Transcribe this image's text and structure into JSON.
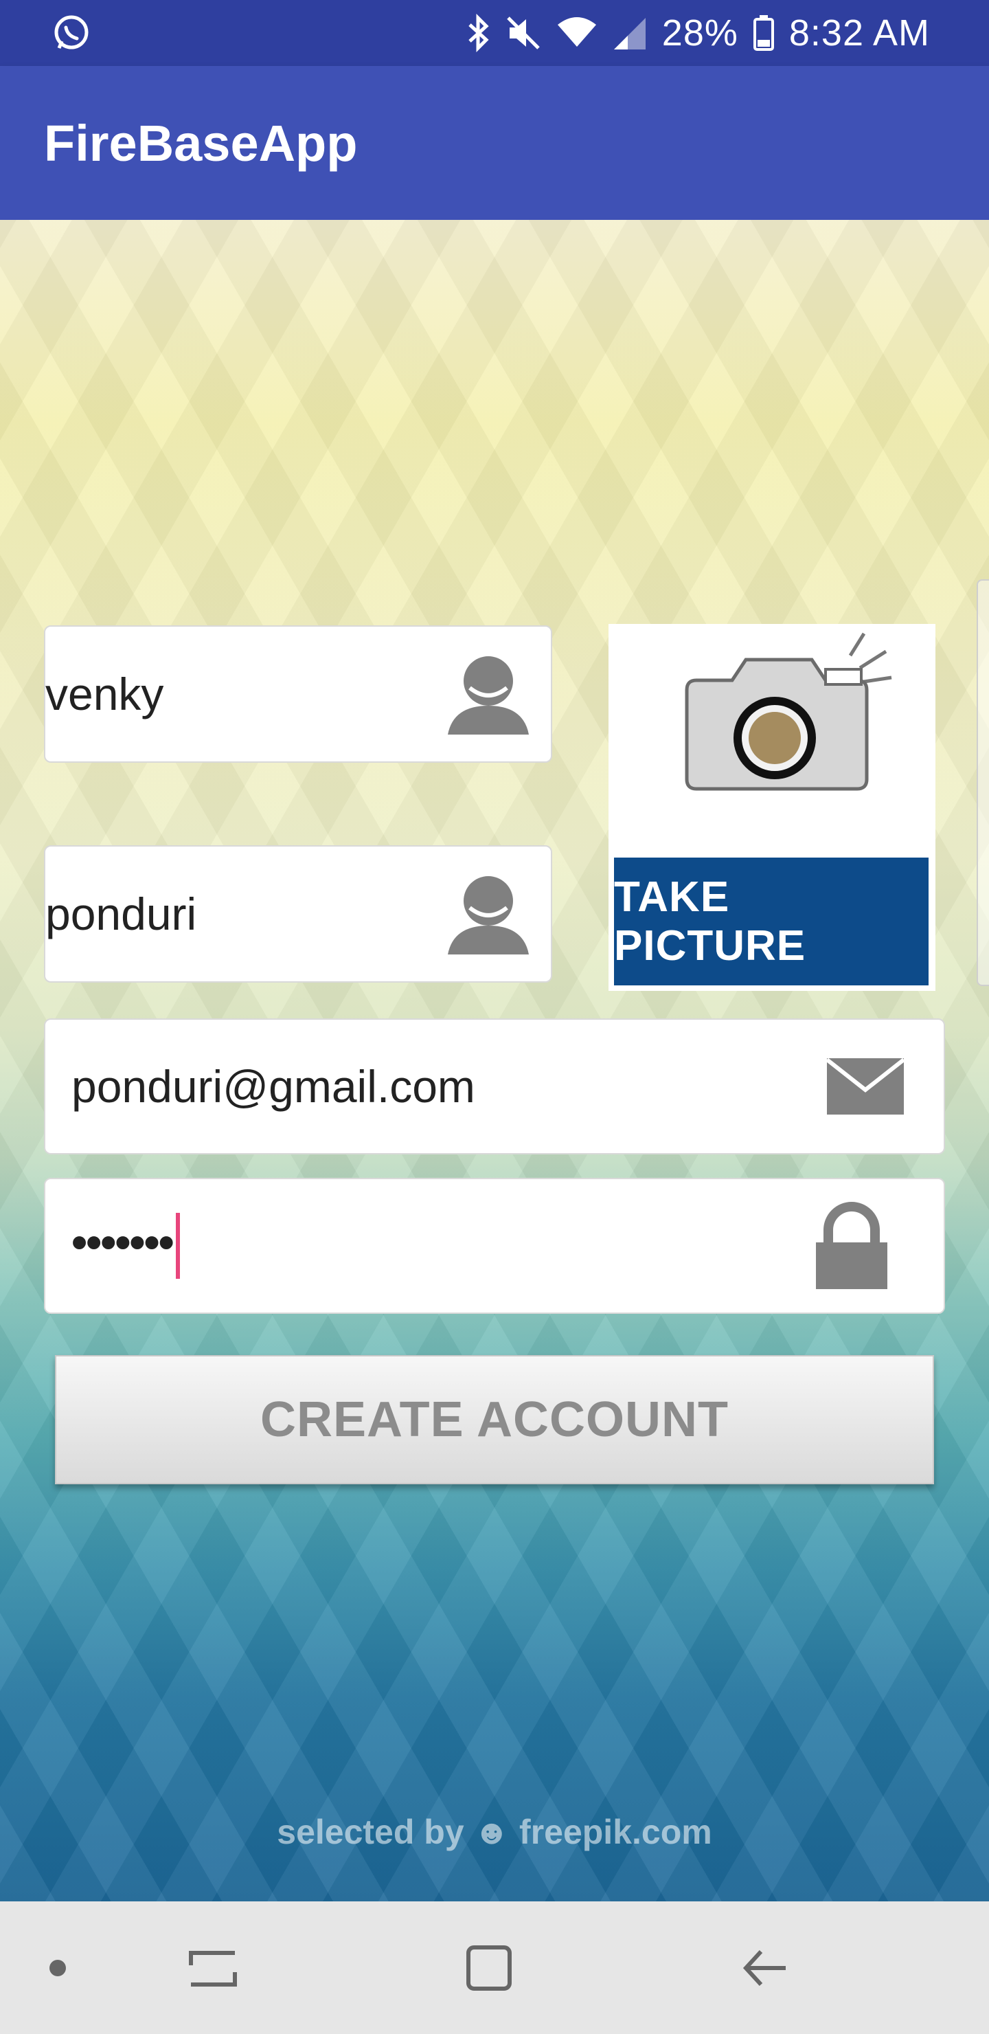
{
  "status_bar": {
    "battery": "28%",
    "time": "8:32 AM",
    "icons": [
      "whatsapp-icon",
      "bluetooth-icon",
      "mute-icon",
      "wifi-icon",
      "signal-icon",
      "battery-icon"
    ]
  },
  "app_bar": {
    "title": "FireBaseApp"
  },
  "form": {
    "first_name": "venky",
    "last_name": "ponduri",
    "email": "ponduri@gmail.com",
    "password": "•••••••"
  },
  "camera": {
    "label": "TAKE PICTURE"
  },
  "create_button": {
    "label": "CREATE ACCOUNT"
  },
  "watermark": "selected by ☻ freepik.com",
  "colors": {
    "primary": "#3f51b5",
    "primary_dark": "#2f3f9f",
    "accent_cursor": "#e8457c",
    "take_picture_bg": "#0d4b8a"
  }
}
